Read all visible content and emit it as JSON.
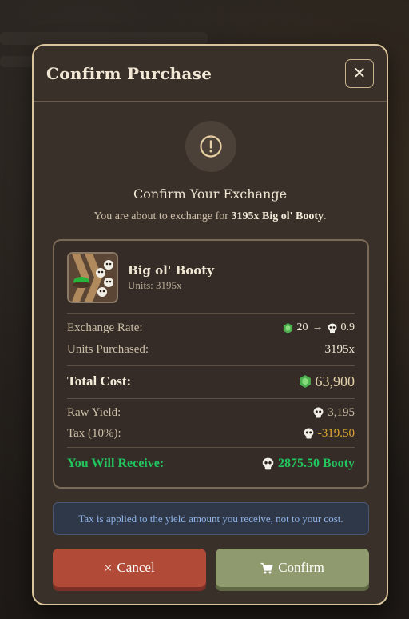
{
  "modal": {
    "title": "Confirm Purchase",
    "close_symbol": "✕",
    "alert_icon": "exclamation-circle-icon",
    "heading": "Confirm Your Exchange",
    "sub_prefix": "You are about to exchange for ",
    "sub_item": "3195x Big ol' Booty",
    "sub_suffix": "."
  },
  "item": {
    "name": "Big ol' Booty",
    "units": "Units: 3195x"
  },
  "details": {
    "rate_label": "Exchange Rate:",
    "rate_from": "20",
    "rate_arrow": "→",
    "rate_to": "0.9",
    "units_label": "Units Purchased:",
    "units_value": "3195x",
    "total_label": "Total Cost:",
    "total_value": "63,900",
    "raw_label": "Raw Yield:",
    "raw_value": "3,195",
    "tax_label": "Tax (10%):",
    "tax_value": "-319.50",
    "receive_label": "You Will Receive:",
    "receive_value": "2875.50 Booty"
  },
  "info_text": "Tax is applied to the yield amount you receive, not to your cost.",
  "buttons": {
    "cancel": "Cancel",
    "cancel_icon": "×",
    "confirm": "Confirm",
    "confirm_icon": "cart-icon"
  },
  "colors": {
    "accent_green": "#22c55e",
    "cancel": "#b24a38",
    "confirm": "#8f9b6e",
    "tax": "#e3a730",
    "border_gold": "#d9c39a"
  }
}
